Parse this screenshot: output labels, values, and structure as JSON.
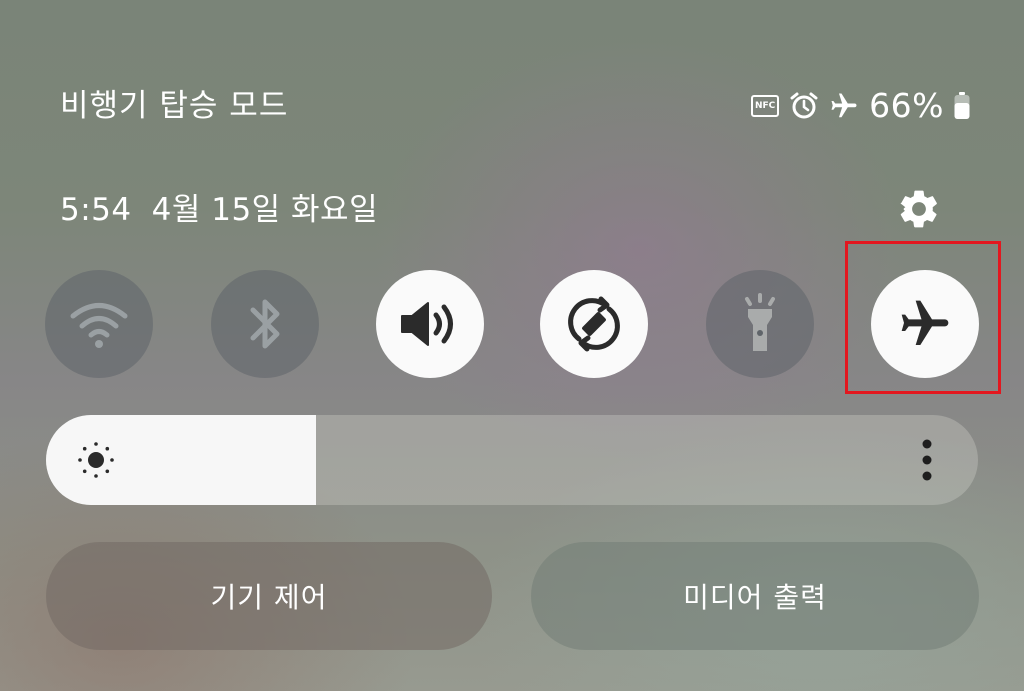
{
  "status_bar": {
    "mode_title": "비행기 탑승 모드",
    "nfc_label": "NFC",
    "battery_percent": "66%",
    "icons": [
      "nfc-icon",
      "alarm-icon",
      "airplane-icon",
      "battery-icon"
    ]
  },
  "header": {
    "time": "5:54",
    "date": "4월 15일 화요일",
    "settings_icon": "gear-icon"
  },
  "quick_toggles": [
    {
      "name": "wifi",
      "icon": "wifi-icon",
      "state": "off"
    },
    {
      "name": "bluetooth",
      "icon": "bluetooth-icon",
      "state": "off"
    },
    {
      "name": "sound",
      "icon": "speaker-icon",
      "state": "on"
    },
    {
      "name": "auto-rotate",
      "icon": "rotate-icon",
      "state": "on"
    },
    {
      "name": "flashlight",
      "icon": "flashlight-icon",
      "state": "off"
    },
    {
      "name": "airplane-mode",
      "icon": "airplane-icon",
      "state": "on"
    }
  ],
  "brightness": {
    "level": 0.29,
    "icon": "sun-icon",
    "more_icon": "more-vertical-icon"
  },
  "buttons": {
    "device_control": "기기 제어",
    "media_output": "미디어 출력"
  },
  "colors": {
    "tile_on": "#fafafa",
    "tile_off": "#5f6469",
    "icon_on": "#2b2b2b",
    "highlight": "#e3171f"
  }
}
